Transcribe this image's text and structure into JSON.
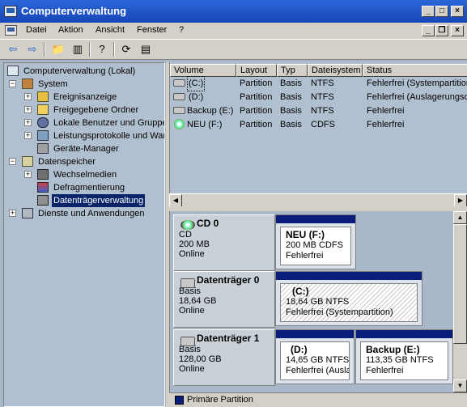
{
  "window": {
    "title": "Computerverwaltung",
    "colors": {
      "titlebar": "#1f56c8",
      "selection": "#0a246a",
      "primary_partition": "#0a1d7a"
    }
  },
  "menubar": {
    "items": [
      "Datei",
      "Aktion",
      "Ansicht",
      "Fenster",
      "?"
    ]
  },
  "tree": {
    "items": [
      {
        "label": "Computerverwaltung (Lokal)",
        "icon": "computer-icon"
      },
      {
        "label": "System",
        "icon": "tools-icon"
      },
      {
        "label": "Ereignisanzeige",
        "icon": "event-viewer-icon"
      },
      {
        "label": "Freigegebene Ordner",
        "icon": "shared-folder-icon"
      },
      {
        "label": "Lokale Benutzer und Gruppen",
        "icon": "users-icon"
      },
      {
        "label": "Leistungsprotokolle und Warnungen",
        "icon": "performance-icon"
      },
      {
        "label": "Geräte-Manager",
        "icon": "device-manager-icon"
      },
      {
        "label": "Datenspeicher",
        "icon": "storage-icon"
      },
      {
        "label": "Wechselmedien",
        "icon": "removable-media-icon"
      },
      {
        "label": "Defragmentierung",
        "icon": "defrag-icon"
      },
      {
        "label": "Datenträgerverwaltung",
        "icon": "disk-management-icon"
      },
      {
        "label": "Dienste und Anwendungen",
        "icon": "services-icon"
      }
    ]
  },
  "volume_list": {
    "columns": [
      "Volume",
      "Layout",
      "Typ",
      "Dateisystem",
      "Status"
    ],
    "rows": [
      {
        "volume": "(C:)",
        "layout": "Partition",
        "typ": "Basis",
        "fs": "NTFS",
        "status": "Fehlerfrei (Systempartition)",
        "icon": "hard-drive-icon"
      },
      {
        "volume": "(D:)",
        "layout": "Partition",
        "typ": "Basis",
        "fs": "NTFS",
        "status": "Fehlerfrei (Auslagerungsdatei)",
        "icon": "hard-drive-icon"
      },
      {
        "volume": "Backup (E:)",
        "layout": "Partition",
        "typ": "Basis",
        "fs": "NTFS",
        "status": "Fehlerfrei",
        "icon": "hard-drive-icon"
      },
      {
        "volume": "NEU (F:)",
        "layout": "Partition",
        "typ": "Basis",
        "fs": "CDFS",
        "status": "Fehlerfrei",
        "icon": "cd-icon"
      }
    ]
  },
  "disks": [
    {
      "name": "CD 0",
      "type": "CD",
      "size": "200 MB",
      "state": "Online",
      "icon": "cd-drive-icon",
      "partitions": [
        {
          "name": "NEU  (F:)",
          "size": "200 MB CDFS",
          "status": "Fehlerfrei"
        }
      ]
    },
    {
      "name": "Datenträger 0",
      "type": "Basis",
      "size": "18,64 GB",
      "state": "Online",
      "icon": "disk-icon",
      "partitions": [
        {
          "name": "(C:)",
          "size": "18,64 GB NTFS",
          "status": "Fehlerfrei (Systempartition)"
        }
      ]
    },
    {
      "name": "Datenträger 1",
      "type": "Basis",
      "size": "128,00 GB",
      "state": "Online",
      "icon": "disk-icon",
      "partitions": [
        {
          "name": "(D:)",
          "size": "14,65 GB NTFS",
          "status": "Fehlerfrei (Auslag"
        },
        {
          "name": "Backup  (E:)",
          "size": "113,35 GB NTFS",
          "status": "Fehlerfrei"
        }
      ]
    }
  ],
  "legend": {
    "label": "Primäre Partition"
  }
}
